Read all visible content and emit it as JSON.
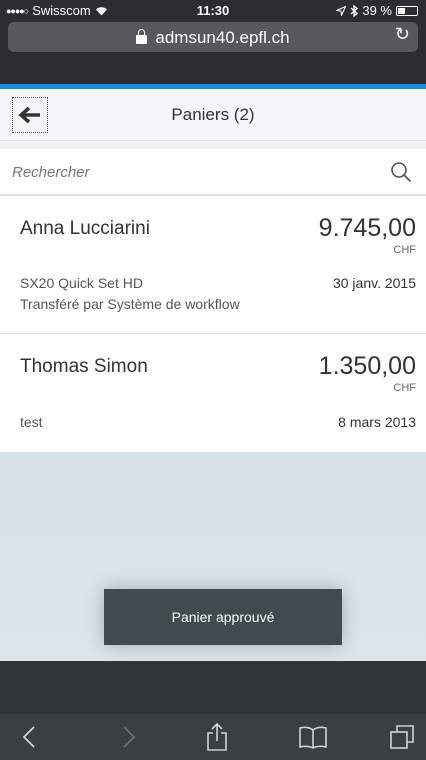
{
  "status_bar": {
    "signal": "●●●●○",
    "carrier": "Swisscom",
    "time": "11:30",
    "battery_percent": "39 %",
    "battery_level": 0.39
  },
  "browser": {
    "url": "admsun40.epfl.ch",
    "reload_icon": "reload-icon"
  },
  "header": {
    "title": "Paniers (2)",
    "back_icon": "arrow-left-icon"
  },
  "search": {
    "placeholder": "Rechercher",
    "value": ""
  },
  "items": [
    {
      "name": "Anna Lucciarini",
      "amount": "9.745,00",
      "currency": "CHF",
      "description": "SX20 Quick Set HD",
      "subtitle": "Transféré par Système de workflow",
      "date": "30 janv. 2015"
    },
    {
      "name": "Thomas Simon",
      "amount": "1.350,00",
      "currency": "CHF",
      "description": "test",
      "date": "8 mars 2013"
    }
  ],
  "toast": {
    "message": "Panier approuvé"
  },
  "toolbar": {
    "buttons": [
      "back-icon",
      "forward-icon",
      "share-icon",
      "bookmarks-icon",
      "tabs-icon"
    ]
  },
  "colors": {
    "accent": "#1a8ddb",
    "toast_bg": "#414a4f",
    "footer_bg": "#2f3538"
  }
}
